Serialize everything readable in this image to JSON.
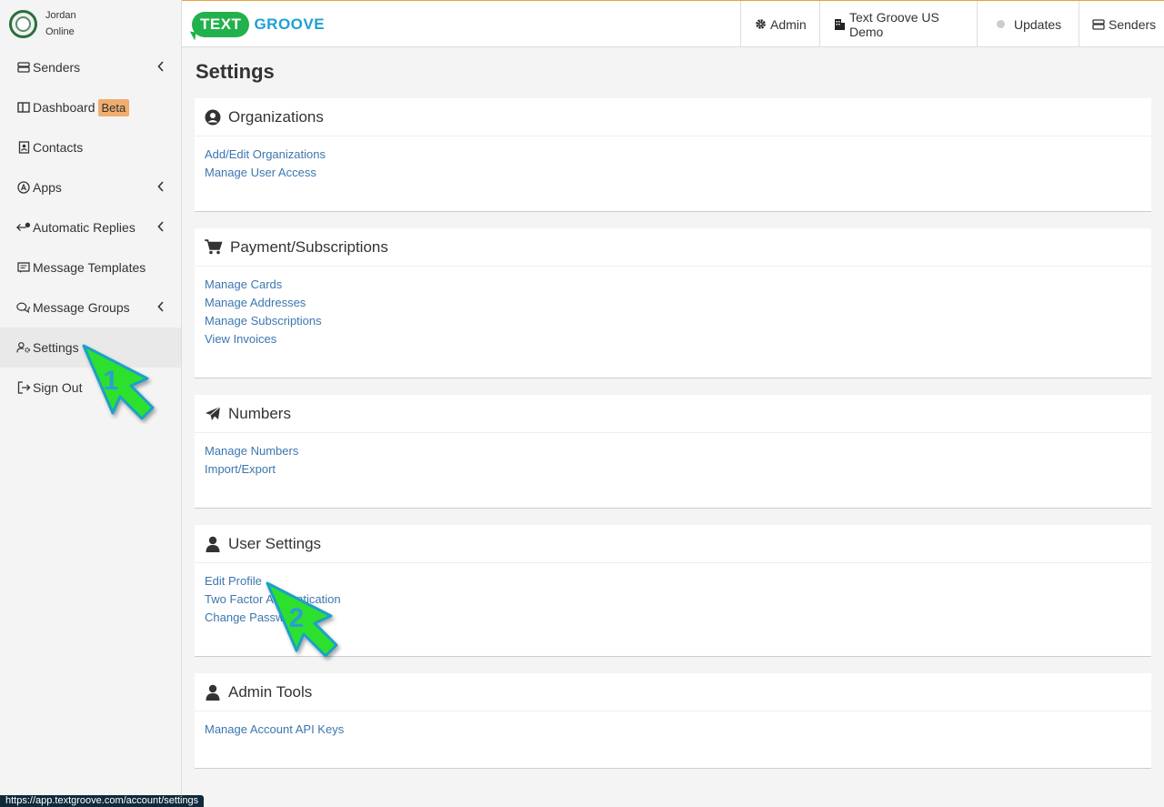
{
  "user": {
    "name": "Jordan",
    "status": "Online"
  },
  "logo": {
    "part1": "TEXT",
    "part2": "GROOVE"
  },
  "topnav": {
    "admin": "Admin",
    "org": "Text Groove US Demo",
    "updates": "Updates",
    "senders": "Senders"
  },
  "sidebar": {
    "items": [
      {
        "label": "Senders",
        "icon": "inbox-stack-icon"
      },
      {
        "label": "Dashboard",
        "icon": "dashboard-icon",
        "badge": "Beta"
      },
      {
        "label": "Contacts",
        "icon": "contact-card-icon"
      },
      {
        "label": "Apps",
        "icon": "app-store-icon"
      },
      {
        "label": "Automatic Replies",
        "icon": "reply-icon"
      },
      {
        "label": "Message Templates",
        "icon": "template-icon"
      },
      {
        "label": "Message Groups",
        "icon": "chat-group-icon"
      },
      {
        "label": "Settings",
        "icon": "user-gear-icon"
      },
      {
        "label": "Sign Out",
        "icon": "sign-out-icon"
      }
    ]
  },
  "page": {
    "title": "Settings"
  },
  "sections": {
    "organizations": {
      "title": "Organizations",
      "links": [
        "Add/Edit Organizations",
        "Manage User Access"
      ]
    },
    "payment": {
      "title": "Payment/Subscriptions",
      "links": [
        "Manage Cards",
        "Manage Addresses",
        "Manage Subscriptions",
        "View Invoices"
      ]
    },
    "numbers": {
      "title": "Numbers",
      "links": [
        "Manage Numbers",
        "Import/Export"
      ]
    },
    "user_settings": {
      "title": "User Settings",
      "links": [
        "Edit Profile",
        "Two Factor Authentication",
        "Change Password"
      ]
    },
    "admin_tools": {
      "title": "Admin Tools",
      "links": [
        "Manage Account API Keys"
      ]
    }
  },
  "annotations": {
    "step1": "1",
    "step2": "2"
  },
  "statusbar": {
    "url": "https://app.textgroove.com/account/settings"
  },
  "colors": {
    "accent_green": "#22b14c",
    "logo_blue": "#1e9fd6",
    "link": "#3c76b0",
    "beta_badge": "#f0ad70"
  }
}
